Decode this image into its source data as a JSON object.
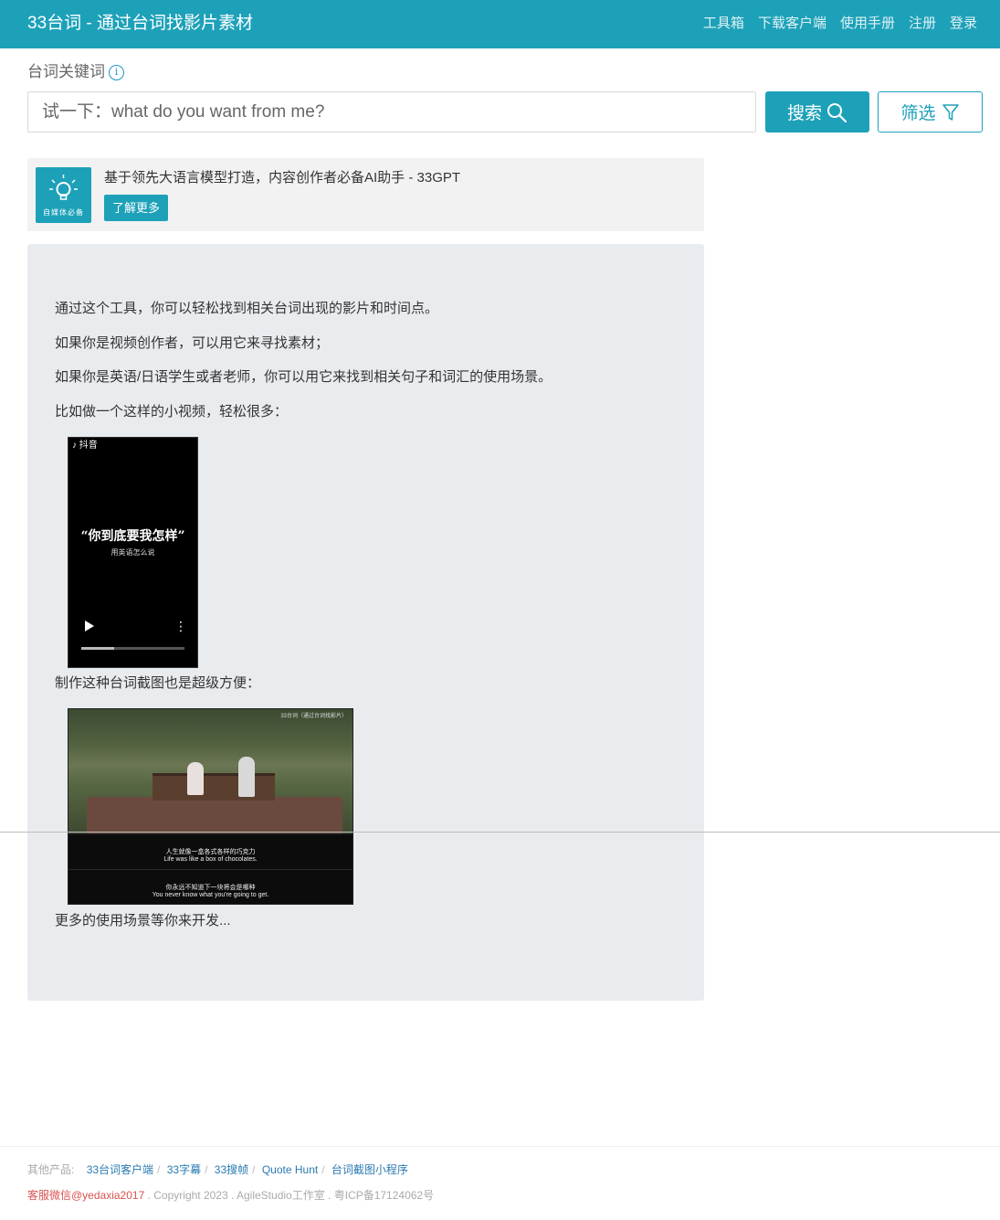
{
  "header": {
    "title": "33台词 - 通过台词找影片素材",
    "nav": [
      "工具箱",
      "下载客户端",
      "使用手册",
      "注册",
      "登录"
    ]
  },
  "search": {
    "label": "台词关键词",
    "placeholder": "试一下：what do you want from me?",
    "search_label": "搜索",
    "filter_label": "筛选"
  },
  "ad": {
    "logo_text": "自媒体必备",
    "text": "基于领先大语言模型打造，内容创作者必备AI助手 - 33GPT",
    "button": "了解更多"
  },
  "intro": {
    "lines": [
      "通过这个工具，你可以轻松找到相关台词出现的影片和时间点。",
      "如果你是视频创作者，可以用它来寻找素材；",
      "如果你是英语/日语学生或者老师，你可以用它来找到相关句子和词汇的使用场景。",
      "比如做一个这样的小视频，轻松很多："
    ],
    "video": {
      "app_name": "抖音",
      "quote": "“你到底要我怎样”",
      "caption": "用英语怎么说",
      "progress": 0.32
    },
    "screenshot_label": "制作这种台词截图也是超级方便：",
    "screenshot": {
      "watermark": "33台词（通过台词找影片）",
      "sub1_zh": "人生就像一盒各式各样的巧克力",
      "sub1_en": "Life was like a box of chocolates.",
      "sub2_zh": "你永远不知道下一块将会是哪种",
      "sub2_en": "You never know what you're going to get."
    },
    "more": "更多的使用场景等你来开发..."
  },
  "footer": {
    "others_label": "其他产品:",
    "links": [
      "33台词客户端",
      "33字幕",
      "33搜帧",
      "Quote Hunt",
      "台词截图小程序"
    ],
    "contact": "客服微信@yedaxia2017",
    "copyright": "Copyright 2023 . AgileStudio工作室 . 粤ICP备17124062号"
  },
  "colors": {
    "primary": "#1da1b9",
    "link": "#2a7ab0",
    "contact": "#d9534f",
    "intro_bg": "#e9ecef",
    "ad_bg": "#f2f2f2"
  }
}
